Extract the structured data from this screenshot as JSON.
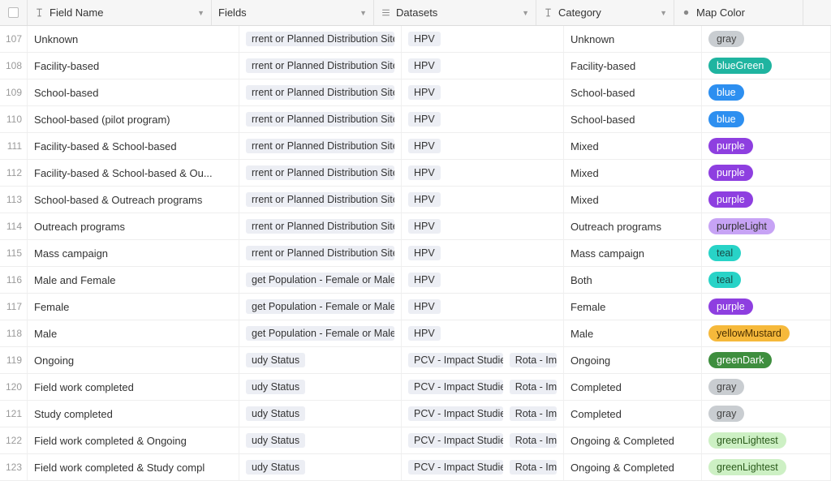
{
  "columns": {
    "fieldName": {
      "label": "Field Name",
      "typeIcon": "text"
    },
    "fields": {
      "label": "Fields",
      "typeIcon": "link"
    },
    "datasets": {
      "label": "Datasets",
      "typeIcon": "link"
    },
    "category": {
      "label": "Category",
      "typeIcon": "text"
    },
    "mapColor": {
      "label": "Map Color",
      "typeIcon": "select"
    }
  },
  "rows": [
    {
      "num": "107",
      "fieldName": "Unknown",
      "fields": [
        "rrent or Planned Distribution Site"
      ],
      "datasets": [
        "HPV"
      ],
      "category": "Unknown",
      "mapColor": "gray"
    },
    {
      "num": "108",
      "fieldName": "Facility-based",
      "fields": [
        "rrent or Planned Distribution Site"
      ],
      "datasets": [
        "HPV"
      ],
      "category": "Facility-based",
      "mapColor": "blueGreen"
    },
    {
      "num": "109",
      "fieldName": "School-based",
      "fields": [
        "rrent or Planned Distribution Site"
      ],
      "datasets": [
        "HPV"
      ],
      "category": "School-based",
      "mapColor": "blue"
    },
    {
      "num": "110",
      "fieldName": "School-based (pilot program)",
      "fields": [
        "rrent or Planned Distribution Site"
      ],
      "datasets": [
        "HPV"
      ],
      "category": "School-based",
      "mapColor": "blue"
    },
    {
      "num": "111",
      "fieldName": "Facility-based & School-based",
      "fields": [
        "rrent or Planned Distribution Site"
      ],
      "datasets": [
        "HPV"
      ],
      "category": "Mixed",
      "mapColor": "purple"
    },
    {
      "num": "112",
      "fieldName": "Facility-based & School-based & Ou...",
      "fields": [
        "rrent or Planned Distribution Site"
      ],
      "datasets": [
        "HPV"
      ],
      "category": "Mixed",
      "mapColor": "purple"
    },
    {
      "num": "113",
      "fieldName": "School-based & Outreach programs",
      "fields": [
        "rrent or Planned Distribution Site"
      ],
      "datasets": [
        "HPV"
      ],
      "category": "Mixed",
      "mapColor": "purple"
    },
    {
      "num": "114",
      "fieldName": "Outreach programs",
      "fields": [
        "rrent or Planned Distribution Site"
      ],
      "datasets": [
        "HPV"
      ],
      "category": "Outreach programs",
      "mapColor": "purpleLight"
    },
    {
      "num": "115",
      "fieldName": "Mass campaign",
      "fields": [
        "rrent or Planned Distribution Site"
      ],
      "datasets": [
        "HPV"
      ],
      "category": "Mass campaign",
      "mapColor": "teal"
    },
    {
      "num": "116",
      "fieldName": "Male and Female",
      "fields": [
        "get Population - Female or Male"
      ],
      "datasets": [
        "HPV"
      ],
      "category": "Both",
      "mapColor": "teal"
    },
    {
      "num": "117",
      "fieldName": "Female",
      "fields": [
        "get Population - Female or Male"
      ],
      "datasets": [
        "HPV"
      ],
      "category": "Female",
      "mapColor": "purple"
    },
    {
      "num": "118",
      "fieldName": "Male",
      "fields": [
        "get Population - Female or Male"
      ],
      "datasets": [
        "HPV"
      ],
      "category": "Male",
      "mapColor": "yellowMustard"
    },
    {
      "num": "119",
      "fieldName": "Ongoing",
      "fields": [
        "udy Status"
      ],
      "datasets": [
        "PCV - Impact Studies",
        "Rota - Im"
      ],
      "category": "Ongoing",
      "mapColor": "greenDark"
    },
    {
      "num": "120",
      "fieldName": "Field work completed",
      "fields": [
        "udy Status"
      ],
      "datasets": [
        "PCV - Impact Studies",
        "Rota - Im"
      ],
      "category": "Completed",
      "mapColor": "gray"
    },
    {
      "num": "121",
      "fieldName": "Study completed",
      "fields": [
        "udy Status"
      ],
      "datasets": [
        "PCV - Impact Studies",
        "Rota - Im"
      ],
      "category": "Completed",
      "mapColor": "gray"
    },
    {
      "num": "122",
      "fieldName": "Field work completed & Ongoing",
      "fields": [
        "udy Status"
      ],
      "datasets": [
        "PCV - Impact Studies",
        "Rota - Im"
      ],
      "category": "Ongoing & Completed",
      "mapColor": "greenLightest"
    },
    {
      "num": "123",
      "fieldName": "Field work completed & Study compl",
      "fields": [
        "udy Status"
      ],
      "datasets": [
        "PCV - Impact Studies",
        "Rota - Im"
      ],
      "category": "Ongoing & Completed",
      "mapColor": "greenLightest"
    }
  ]
}
